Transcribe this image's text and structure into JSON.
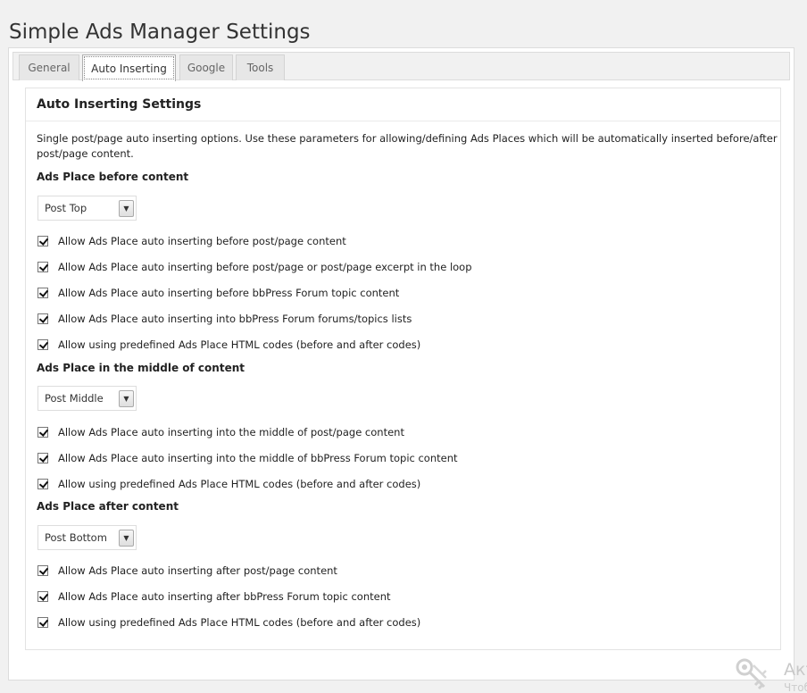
{
  "page": {
    "title": "Simple Ads Manager Settings"
  },
  "tabs": [
    {
      "label": "General",
      "active": false
    },
    {
      "label": "Auto Inserting",
      "active": true
    },
    {
      "label": "Google",
      "active": false
    },
    {
      "label": "Tools",
      "active": false
    }
  ],
  "section": {
    "title": "Auto Inserting Settings",
    "description": "Single post/page auto inserting options. Use these parameters for allowing/defining Ads Places which will be automatically inserted before/after post/page content."
  },
  "groups": [
    {
      "title": "Ads Place before content",
      "select_value": "Post Top",
      "options": [
        {
          "label": "Allow Ads Place auto inserting before post/page content",
          "checked": true
        },
        {
          "label": "Allow Ads Place auto inserting before post/page or post/page excerpt in the loop",
          "checked": true
        },
        {
          "label": "Allow Ads Place auto inserting before bbPress Forum topic content",
          "checked": true
        },
        {
          "label": "Allow Ads Place auto inserting into bbPress Forum forums/topics lists",
          "checked": true
        },
        {
          "label": "Allow using predefined Ads Place HTML codes (before and after codes)",
          "checked": true
        }
      ]
    },
    {
      "title": "Ads Place in the middle of content",
      "select_value": "Post Middle",
      "options": [
        {
          "label": "Allow Ads Place auto inserting into the middle of post/page content",
          "checked": true
        },
        {
          "label": "Allow Ads Place auto inserting into the middle of bbPress Forum topic content",
          "checked": true
        },
        {
          "label": "Allow using predefined Ads Place HTML codes (before and after codes)",
          "checked": true
        }
      ]
    },
    {
      "title": "Ads Place after content",
      "select_value": "Post Bottom",
      "options": [
        {
          "label": "Allow Ads Place auto inserting after post/page content",
          "checked": true
        },
        {
          "label": "Allow Ads Place auto inserting after bbPress Forum topic content",
          "checked": true
        },
        {
          "label": "Allow using predefined Ads Place HTML codes (before and after codes)",
          "checked": true
        }
      ]
    }
  ],
  "watermark": {
    "line1": "Акт",
    "line2": "Чтоб"
  },
  "icons": {
    "select_arrow": "chevron-down-icon",
    "checkbox": "checkmark-icon",
    "watermark": "keys-icon"
  }
}
